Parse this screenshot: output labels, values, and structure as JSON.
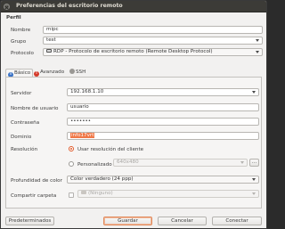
{
  "window": {
    "title": "Preferencias del escritorio remoto"
  },
  "profile": {
    "section_label": "Perfil",
    "name_label": "Nombre",
    "name_value": "mipc",
    "group_label": "Grupo",
    "group_value": "test",
    "protocol_label": "Protocolo",
    "protocol_value": "RDP - Protocolo de escritorio remoto (Remote Desktop Protocol)"
  },
  "tabs": [
    {
      "label": "Básico",
      "icon": "info-icon",
      "active": true
    },
    {
      "label": "Avanzado",
      "icon": "warning-icon",
      "active": false
    },
    {
      "label": "SSH",
      "icon": "ssh-tunnel-icon",
      "active": false
    }
  ],
  "basic": {
    "server_label": "Servidor",
    "server_value": "192.168.1.10",
    "username_label": "Nombre de usuario",
    "username_value": "usuario",
    "password_label": "Contraseña",
    "password_value": "•••••••",
    "domain_label": "Dominio",
    "domain_value": "info17vrt",
    "resolution_label": "Resolución",
    "resolution_client_label": "Usar resolución del cliente",
    "resolution_custom_label": "Personalizado",
    "resolution_custom_value": "640x480",
    "resolution_more_label": "...",
    "color_depth_label": "Profundidad de color",
    "color_depth_value": "Color verdadero (24 ppp)",
    "share_folder_label": "Compartir carpeta",
    "share_folder_value": "(Ninguno)"
  },
  "buttons": {
    "defaults": "Predeterminados",
    "save": "Guardar",
    "cancel": "Cancelar",
    "connect": "Conectar"
  },
  "colors": {
    "accent": "#f07746",
    "titlebar": "#3c3b37",
    "info_icon": "#3b73c6",
    "warning_icon": "#d43a2a"
  }
}
